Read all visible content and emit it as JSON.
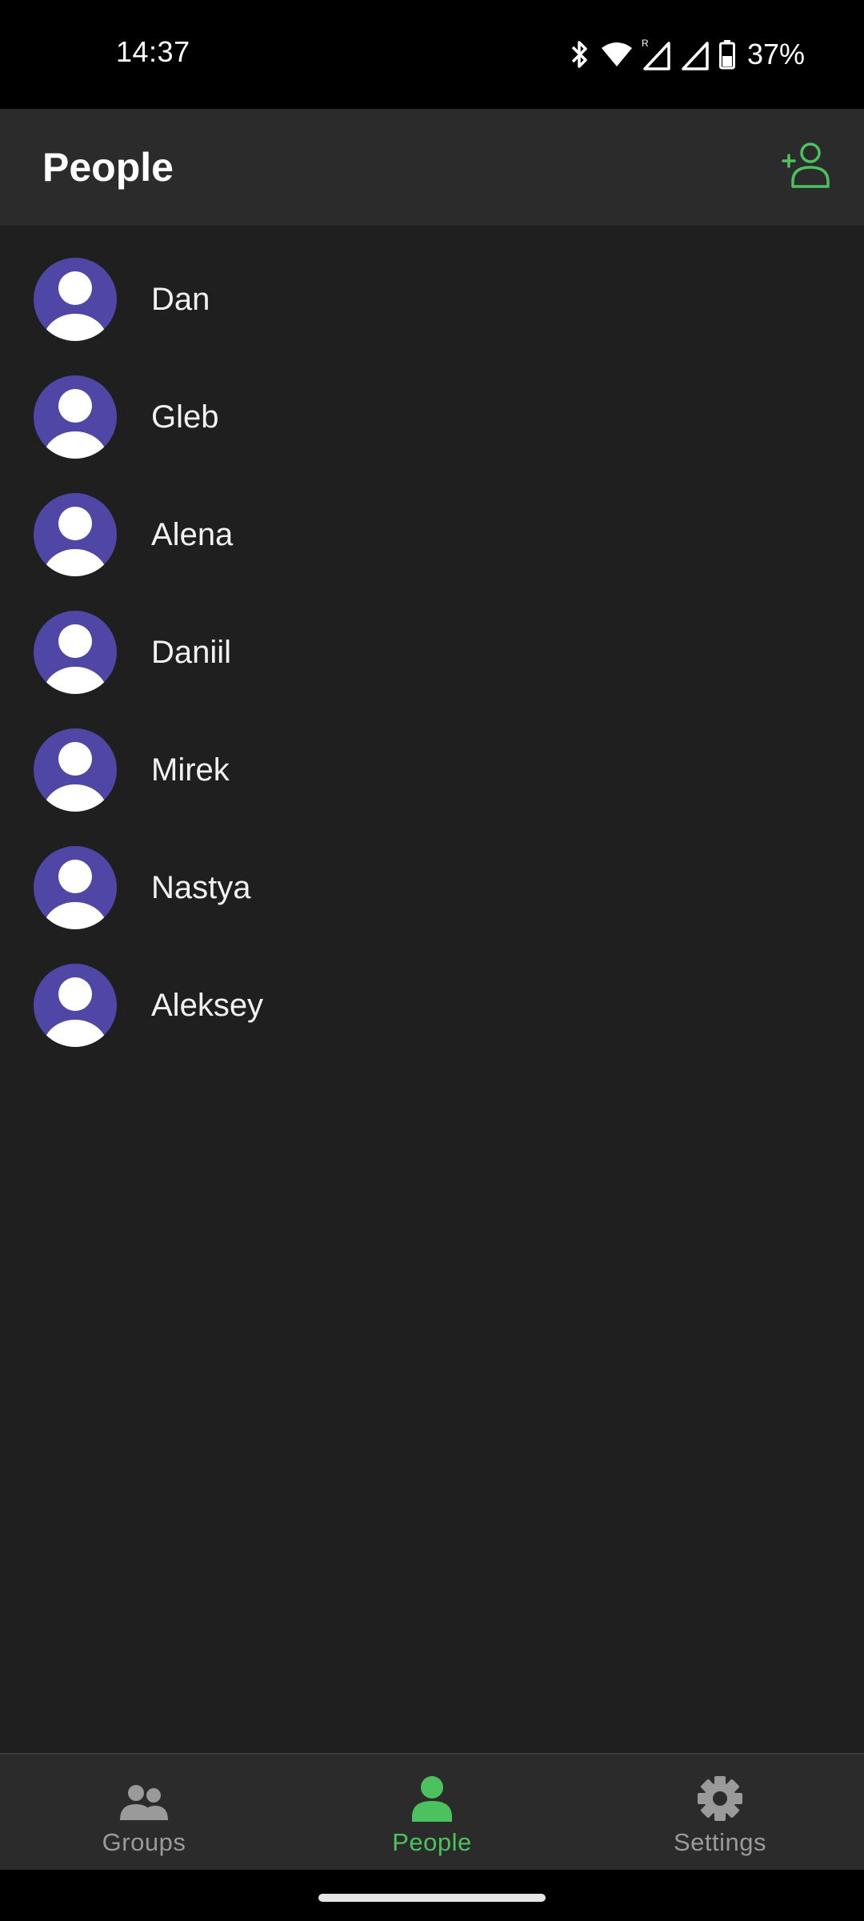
{
  "status_bar": {
    "time": "14:37",
    "battery": "37%",
    "icons": [
      "bluetooth-icon",
      "wifi-icon",
      "signal-roaming-icon",
      "signal-icon",
      "battery-icon"
    ]
  },
  "app_bar": {
    "title": "People",
    "action_icon": "add-person-icon"
  },
  "people": [
    {
      "name": "Dan"
    },
    {
      "name": "Gleb"
    },
    {
      "name": "Alena"
    },
    {
      "name": "Daniil"
    },
    {
      "name": "Mirek"
    },
    {
      "name": "Nastya"
    },
    {
      "name": "Aleksey"
    }
  ],
  "bottom_nav": {
    "items": [
      {
        "label": "Groups",
        "icon": "groups-icon",
        "active": false
      },
      {
        "label": "People",
        "icon": "person-icon",
        "active": true
      },
      {
        "label": "Settings",
        "icon": "gear-icon",
        "active": false
      }
    ]
  },
  "colors": {
    "accent": "#4cc25f",
    "avatar_bg": "#4f46a5",
    "app_bar": "#2b2b2b",
    "background": "#1f1f1f",
    "inactive": "#9a9a9a"
  }
}
